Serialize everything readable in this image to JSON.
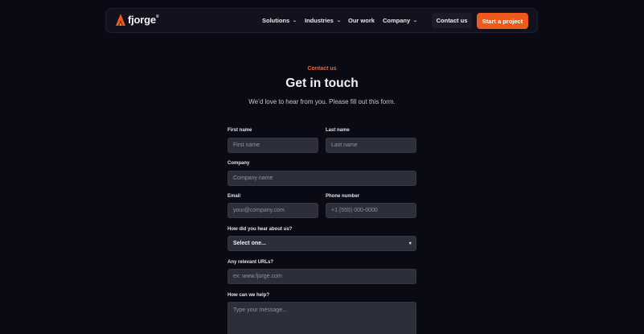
{
  "nav": {
    "logo_text": "fjorge",
    "logo_mark": "®",
    "links": [
      {
        "label": "Solutions",
        "has_dropdown": true
      },
      {
        "label": "Industries",
        "has_dropdown": true
      },
      {
        "label": "Our work",
        "has_dropdown": false
      },
      {
        "label": "Company",
        "has_dropdown": true
      }
    ],
    "chevron": "⌄",
    "contact_label": "Contact us",
    "start_label": "Start a project"
  },
  "hero": {
    "eyebrow": "Contact us",
    "title": "Get in touch",
    "subtitle": "We’d love to hear from you. Please fill out this form."
  },
  "form": {
    "first_name": {
      "label": "First name",
      "placeholder": "First name"
    },
    "last_name": {
      "label": "Last name",
      "placeholder": "Last name"
    },
    "company": {
      "label": "Company",
      "placeholder": "Company name"
    },
    "email": {
      "label": "Email",
      "placeholder": "your@company.com"
    },
    "phone": {
      "label": "Phone number",
      "placeholder": "+1 (555) 000-0000"
    },
    "source": {
      "label": "How did you hear about us?",
      "value": "Select one..."
    },
    "urls": {
      "label": "Any relevant URLs?",
      "placeholder": "ex: www.fjorge.com"
    },
    "message": {
      "label": "How can we help?",
      "placeholder": "Type your message..."
    }
  },
  "colors": {
    "background": "#090a14",
    "accent": "#ee5a1c",
    "field_bg": "#2c2e3a"
  },
  "icons": {
    "logo": "flame-logo-icon",
    "dropdown": "chevron-down-icon",
    "select": "caret-down-icon"
  }
}
